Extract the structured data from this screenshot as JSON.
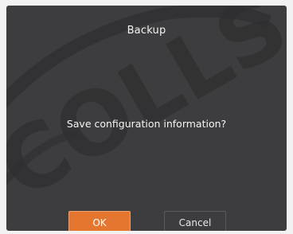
{
  "dialog": {
    "title": "Backup",
    "message": "Save configuration information?",
    "ok_label": "OK",
    "cancel_label": "Cancel"
  },
  "watermark": {
    "text": "COLLSAN"
  },
  "colors": {
    "dialog_background": "#3d3d3f",
    "primary_button": "#e4762f",
    "text": "#f2f2f2"
  }
}
